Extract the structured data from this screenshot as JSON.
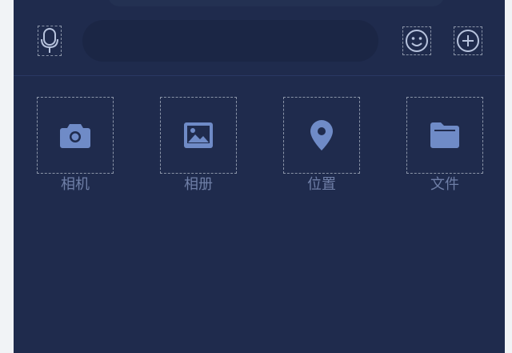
{
  "colors": {
    "background": "#1f2b4d",
    "input_background": "#1b2645",
    "icon_fill": "#6f8bc7",
    "label": "#6f7fa7"
  },
  "input_bar": {
    "mic_icon": "microphone-icon",
    "message_value": "",
    "emoji_icon": "smiley-icon",
    "more_icon": "plus-circle-icon"
  },
  "actions": [
    {
      "label": "相机",
      "icon": "camera-icon"
    },
    {
      "label": "相册",
      "icon": "image-icon"
    },
    {
      "label": "位置",
      "icon": "location-pin-icon"
    },
    {
      "label": "文件",
      "icon": "folder-icon"
    }
  ]
}
